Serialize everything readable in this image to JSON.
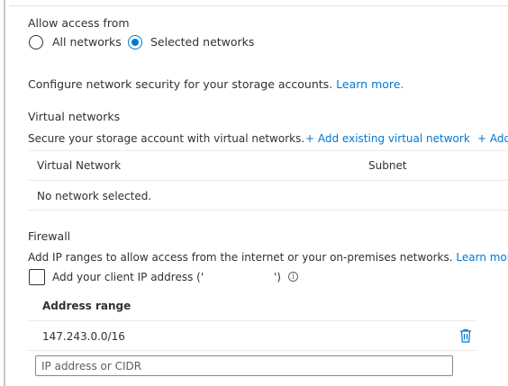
{
  "access": {
    "heading": "Allow access from",
    "options": [
      {
        "label": "All networks",
        "selected": false
      },
      {
        "label": "Selected networks",
        "selected": true
      }
    ]
  },
  "configure": {
    "text": "Configure network security for your storage accounts.",
    "learn_more": "Learn more."
  },
  "virtual_networks": {
    "heading": "Virtual networks",
    "description": "Secure your storage account with virtual networks.",
    "add_existing": "+ Add existing virtual network",
    "add_new": "+ Add",
    "columns": [
      "Virtual Network",
      "Subnet"
    ],
    "empty_text": "No network selected."
  },
  "firewall": {
    "heading": "Firewall",
    "description": "Add IP ranges to allow access from the internet or your on-premises networks.",
    "learn_more": "Learn more.",
    "client_ip": {
      "prefix": "Add your client IP address ('",
      "suffix": "')",
      "checked": false
    },
    "column": "Address range",
    "ranges": [
      "147.243.0.0/16"
    ],
    "input_placeholder": "IP address or CIDR"
  },
  "colors": {
    "accent": "#0078d4",
    "text": "#323130",
    "border": "#edebe9"
  },
  "icons": [
    "radio-icon",
    "info-icon",
    "trash-icon",
    "checkbox-icon"
  ]
}
